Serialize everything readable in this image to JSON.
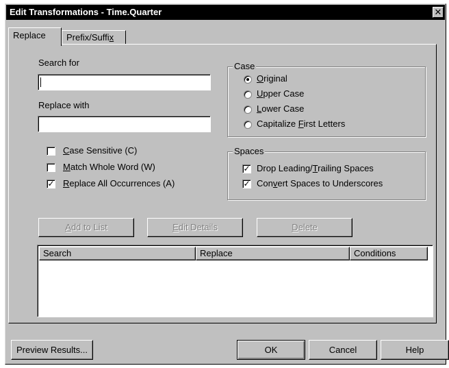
{
  "window": {
    "title": "Edit Transformations - Time.Quarter",
    "close_glyph": "✕"
  },
  "tabs": [
    {
      "label": "Replace"
    },
    {
      "label_pre": "Prefix/Suffi",
      "label_key": "x"
    }
  ],
  "search": {
    "label": "Search for",
    "value": ""
  },
  "replace": {
    "label": "Replace with",
    "value": ""
  },
  "options": {
    "case_sensitive": {
      "key": "C",
      "label_rest": "ase Sensitive (C)",
      "checked": false
    },
    "whole_word": {
      "key": "M",
      "label_rest": "atch Whole Word (W)",
      "checked": false
    },
    "replace_all": {
      "key": "R",
      "label_rest": "eplace All Occurrences (A)",
      "checked": true
    }
  },
  "case_group": {
    "title": "Case",
    "original": {
      "key": "O",
      "label_rest": "riginal",
      "selected": true
    },
    "upper": {
      "key": "U",
      "label_rest": "pper Case",
      "selected": false
    },
    "lower": {
      "key": "L",
      "label_rest": "ower Case",
      "selected": false
    },
    "capitalize": {
      "pre": "Capitalize ",
      "key": "F",
      "label_rest": "irst Letters",
      "selected": false
    }
  },
  "spaces_group": {
    "title": "Spaces",
    "drop": {
      "pre": "Drop Leading/",
      "key": "T",
      "label_rest": "railing Spaces",
      "checked": true
    },
    "convert": {
      "pre": "Con",
      "key": "v",
      "label_rest": "ert Spaces to Underscores",
      "checked": true
    }
  },
  "list_buttons": {
    "add": {
      "key": "A",
      "label_rest": "dd to List"
    },
    "edit": {
      "key": "E",
      "label_rest": "dit Details"
    },
    "delete": {
      "key": "D",
      "label_rest": "elete"
    }
  },
  "table": {
    "columns": [
      "Search",
      "Replace",
      "Conditions"
    ],
    "rows": []
  },
  "footer": {
    "preview": "Preview Results...",
    "ok": "OK",
    "cancel": "Cancel",
    "help": "Help"
  },
  "colors": {
    "face": "#c0c0c0",
    "titlebar": "#000000",
    "disabled_text": "#808080"
  },
  "check_glyph": "✓"
}
